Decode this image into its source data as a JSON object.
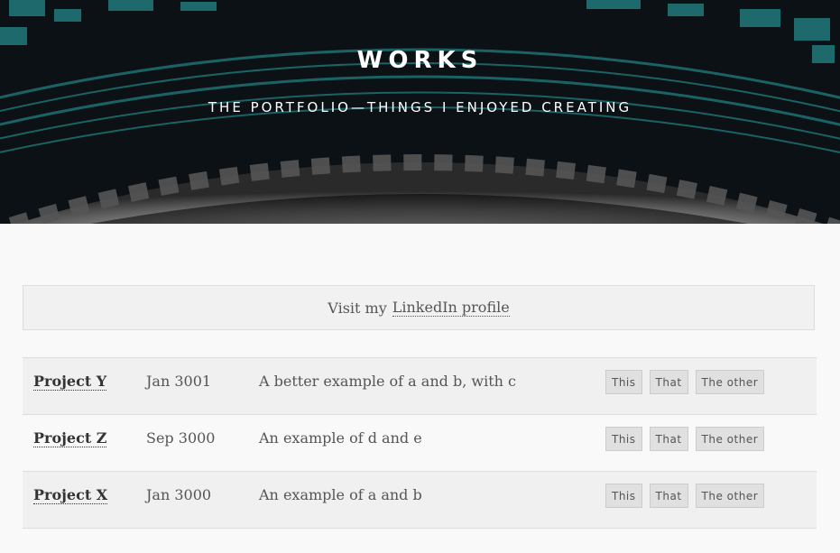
{
  "hero": {
    "title": "WORKS",
    "subtitle": "THE PORTFOLIO—THINGS I ENJOYED CREATING"
  },
  "linkedin": {
    "prefix": "Visit my",
    "link_label": "LinkedIn profile"
  },
  "projects": [
    {
      "name": "Project Y",
      "date": "Jan 3001",
      "description": "A better example of a and b, with c",
      "tags": [
        "This",
        "That",
        "The other"
      ]
    },
    {
      "name": "Project Z",
      "date": "Sep 3000",
      "description": "An example of d and e",
      "tags": [
        "This",
        "That",
        "The other"
      ]
    },
    {
      "name": "Project X",
      "date": "Jan 3000",
      "description": "An example of a and b",
      "tags": [
        "This",
        "That",
        "The other"
      ]
    }
  ],
  "colors": {
    "hero_bg": "#0b1114",
    "teal_accent": "#2aa5a5",
    "page_bg": "#f9f9f9",
    "row_alt_bg": "#f0f0f0",
    "tag_bg": "#e0e0e0"
  }
}
